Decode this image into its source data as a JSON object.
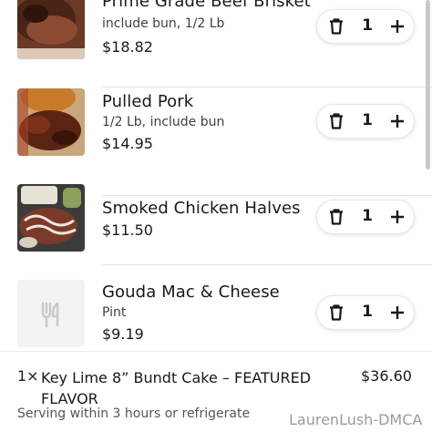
{
  "cart": {
    "items": [
      {
        "name": "Prime Grade Beef Brisket",
        "description": "include bun, 1/2 Lb",
        "price": "$18.82",
        "quantity": "1",
        "image_icon": "brisket-photo"
      },
      {
        "name": "Pulled Pork",
        "description": "1/2 Lb, include bun",
        "price": "$14.95",
        "quantity": "1",
        "image_icon": "pulled-pork-photo"
      },
      {
        "name": "Smoked Chicken Halves",
        "description": "",
        "price": "$11.50",
        "quantity": "1",
        "image_icon": "chicken-photo"
      },
      {
        "name": "Gouda Mac & Cheese",
        "description": "Pint",
        "price": "$9.19",
        "quantity": "1",
        "image_icon": "utensils-icon"
      }
    ],
    "controls": {
      "remove_icon": "trash-icon",
      "add_icon": "plus-icon"
    }
  },
  "order_summary": {
    "item": {
      "quantity": "1×",
      "name": "Key Lime 8” Bundt Cake – FEATURED FLAVOR",
      "price": "$36.60",
      "note": "Serving within 3 hours or refrigerate"
    }
  },
  "watermark": "LaurenLush-DMCA",
  "colors": {
    "text": "#191919",
    "secondary": "#3f3f3f",
    "divider": "#e2e2e2",
    "stepper_border": "#e6e6e6",
    "placeholder_bg": "#f3f3f3"
  }
}
